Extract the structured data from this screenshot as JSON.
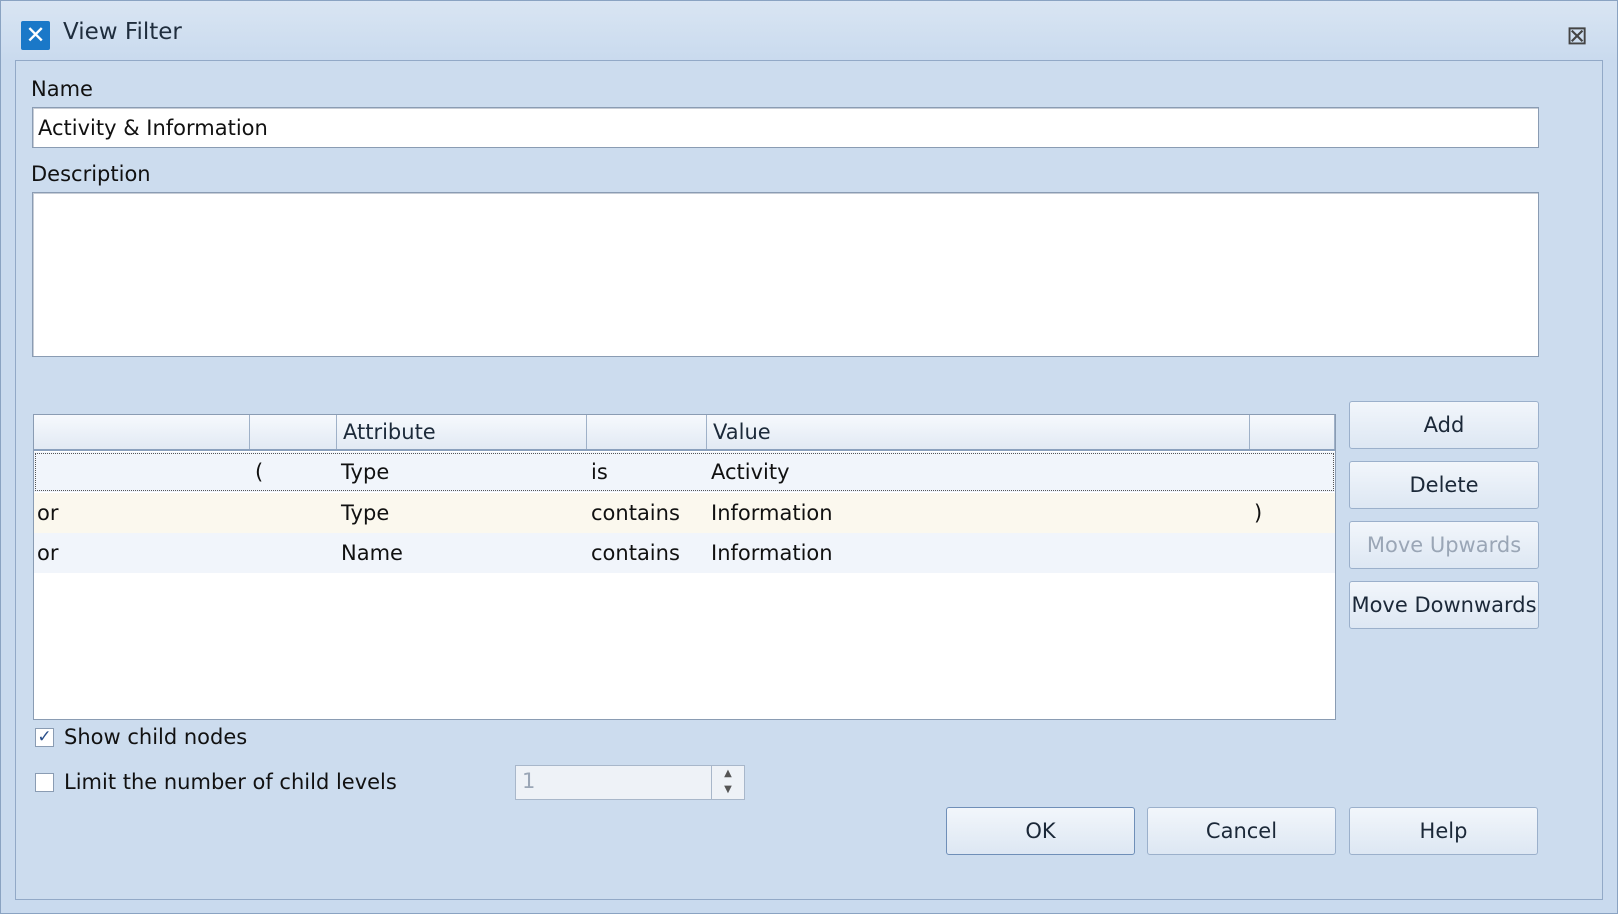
{
  "window": {
    "title": "View Filter"
  },
  "form": {
    "name_label": "Name",
    "name_value": "Activity & Information",
    "description_label": "Description",
    "description_value": ""
  },
  "grid": {
    "headers": [
      "",
      "",
      "Attribute",
      "",
      "Value",
      ""
    ],
    "rows": [
      {
        "op": "",
        "open": "(",
        "attribute": "Type",
        "comparison": "is",
        "value": "Activity",
        "close": ""
      },
      {
        "op": "or",
        "open": "",
        "attribute": "Type",
        "comparison": "contains",
        "value": "Information",
        "close": ")"
      },
      {
        "op": "or",
        "open": "",
        "attribute": "Name",
        "comparison": "contains",
        "value": "Information",
        "close": ""
      }
    ]
  },
  "side_buttons": {
    "add": "Add",
    "delete": "Delete",
    "move_up": "Move Upwards",
    "move_down": "Move Downwards"
  },
  "options": {
    "show_child_nodes_label": "Show child nodes",
    "show_child_nodes_checked": true,
    "limit_levels_label": "Limit the number of child levels",
    "limit_levels_checked": false,
    "limit_levels_value": "1"
  },
  "footer": {
    "ok": "OK",
    "cancel": "Cancel",
    "help": "Help"
  },
  "icons": {
    "app": "app-x-icon",
    "close": "close-icon"
  }
}
